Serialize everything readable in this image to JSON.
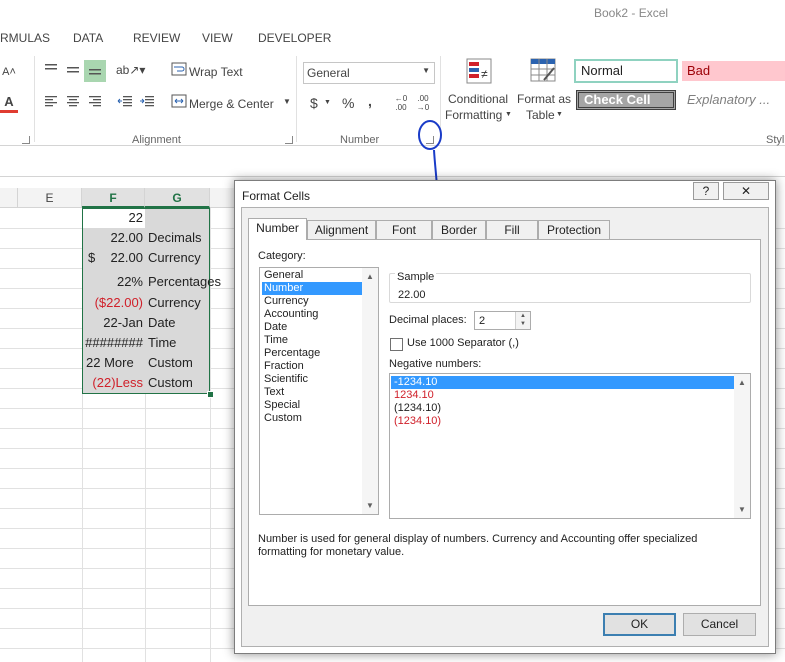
{
  "window": {
    "title": "Book2 - Excel"
  },
  "ribbon_tabs": [
    "RMULAS",
    "DATA",
    "REVIEW",
    "VIEW",
    "DEVELOPER"
  ],
  "ribbon": {
    "wrap_text": "Wrap Text",
    "merge_center": "Merge & Center",
    "alignment_group": "Alignment",
    "number_format": "General",
    "currency_symbol": "$",
    "percent_symbol": "%",
    "comma_symbol": ",",
    "inc_decimal": "←0\n.00",
    "dec_decimal": ".00\n→0",
    "number_group": "Number",
    "conditional_formatting": [
      "Conditional",
      "Formatting"
    ],
    "format_as_table": [
      "Format as",
      "Table"
    ],
    "styles": {
      "normal": "Normal",
      "bad": "Bad",
      "check_cell": "Check Cell",
      "explanatory": "Explanatory ..."
    },
    "styles_group_cut": "Styl"
  },
  "sheet": {
    "columns": [
      "E",
      "F",
      "G"
    ],
    "rows": [
      {
        "f": "22",
        "g": "",
        "f_red": false
      },
      {
        "f": "22.00",
        "g": "Decimals",
        "f_red": false
      },
      {
        "f": "$   22.00",
        "g": "Currency",
        "f_red": false
      },
      {
        "f": "22%",
        "g": "Percentages",
        "f_red": false
      },
      {
        "f": "($22.00)",
        "g": "Currency",
        "f_red": true
      },
      {
        "f": "22-Jan",
        "g": "Date",
        "f_red": false
      },
      {
        "f": "########",
        "g": "Time",
        "f_red": false
      },
      {
        "f": "22  More",
        "g": "Custom",
        "f_red": false
      },
      {
        "f": "(22)Less",
        "g": "Custom",
        "f_red": true
      }
    ]
  },
  "dialog": {
    "title": "Format Cells",
    "help": "?",
    "close": "✕",
    "tabs": [
      "Number",
      "Alignment",
      "Font",
      "Border",
      "Fill",
      "Protection"
    ],
    "category_label": "Category:",
    "categories": [
      "General",
      "Number",
      "Currency",
      "Accounting",
      "Date",
      "Time",
      "Percentage",
      "Fraction",
      "Scientific",
      "Text",
      "Special",
      "Custom"
    ],
    "selected_category": "Number",
    "sample_label": "Sample",
    "sample_value": "22.00",
    "decimal_label": "Decimal places:",
    "decimal_value": "2",
    "separator_label": "Use 1000 Separator (,)",
    "negative_label": "Negative numbers:",
    "negative_options": [
      {
        "text": "-1234.10",
        "red": false,
        "selected": true
      },
      {
        "text": "1234.10",
        "red": true,
        "selected": false
      },
      {
        "text": "(1234.10)",
        "red": false,
        "selected": false
      },
      {
        "text": "(1234.10)",
        "red": true,
        "selected": false
      }
    ],
    "description": "Number is used for general display of numbers.  Currency and Accounting offer specialized formatting for monetary value.",
    "ok": "OK",
    "cancel": "Cancel"
  },
  "colors": {
    "accent_green": "#217346",
    "selection_blue": "#3399ff",
    "negative_red": "#d0202a",
    "annotation_blue": "#1a3cc8"
  }
}
